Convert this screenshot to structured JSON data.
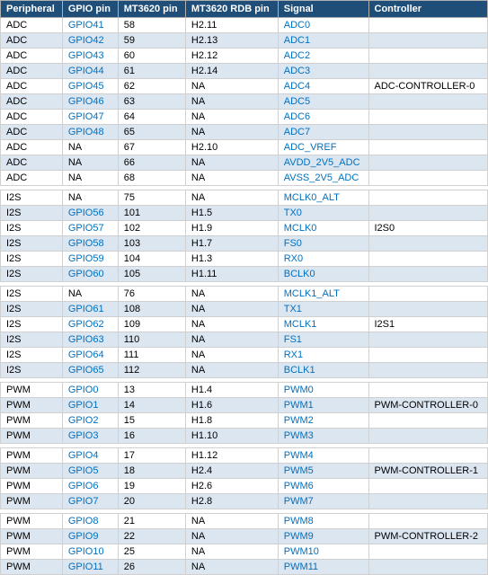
{
  "table": {
    "headers": [
      "Peripheral",
      "GPIO pin",
      "MT3620 pin",
      "MT3620 RDB pin",
      "Signal",
      "Controller"
    ],
    "rows": [
      {
        "peripheral": "ADC",
        "gpio": "GPIO41",
        "mt": "58",
        "rdb": "H2.11",
        "signal": "ADC0",
        "controller": "",
        "bg": "odd"
      },
      {
        "peripheral": "ADC",
        "gpio": "GPIO42",
        "mt": "59",
        "rdb": "H2.13",
        "signal": "ADC1",
        "controller": "",
        "bg": "even"
      },
      {
        "peripheral": "ADC",
        "gpio": "GPIO43",
        "mt": "60",
        "rdb": "H2.12",
        "signal": "ADC2",
        "controller": "",
        "bg": "odd"
      },
      {
        "peripheral": "ADC",
        "gpio": "GPIO44",
        "mt": "61",
        "rdb": "H2.14",
        "signal": "ADC3",
        "controller": "",
        "bg": "even"
      },
      {
        "peripheral": "ADC",
        "gpio": "GPIO45",
        "mt": "62",
        "rdb": "NA",
        "signal": "ADC4",
        "controller": "ADC-CONTROLLER-0",
        "bg": "odd"
      },
      {
        "peripheral": "ADC",
        "gpio": "GPIO46",
        "mt": "63",
        "rdb": "NA",
        "signal": "ADC5",
        "controller": "",
        "bg": "even"
      },
      {
        "peripheral": "ADC",
        "gpio": "GPIO47",
        "mt": "64",
        "rdb": "NA",
        "signal": "ADC6",
        "controller": "",
        "bg": "odd"
      },
      {
        "peripheral": "ADC",
        "gpio": "GPIO48",
        "mt": "65",
        "rdb": "NA",
        "signal": "ADC7",
        "controller": "",
        "bg": "even"
      },
      {
        "peripheral": "ADC",
        "gpio": "NA",
        "mt": "67",
        "rdb": "H2.10",
        "signal": "ADC_VREF",
        "controller": "",
        "bg": "odd"
      },
      {
        "peripheral": "ADC",
        "gpio": "NA",
        "mt": "66",
        "rdb": "NA",
        "signal": "AVDD_2V5_ADC",
        "controller": "",
        "bg": "even"
      },
      {
        "peripheral": "ADC",
        "gpio": "NA",
        "mt": "68",
        "rdb": "NA",
        "signal": "AVSS_2V5_ADC",
        "controller": "",
        "bg": "odd"
      },
      {
        "peripheral": "SPACER",
        "bg": "spacer"
      },
      {
        "peripheral": "I2S",
        "gpio": "NA",
        "mt": "75",
        "rdb": "NA",
        "signal": "MCLK0_ALT",
        "controller": "",
        "bg": "odd"
      },
      {
        "peripheral": "I2S",
        "gpio": "GPIO56",
        "mt": "101",
        "rdb": "H1.5",
        "signal": "TX0",
        "controller": "",
        "bg": "even"
      },
      {
        "peripheral": "I2S",
        "gpio": "GPIO57",
        "mt": "102",
        "rdb": "H1.9",
        "signal": "MCLK0",
        "controller": "I2S0",
        "bg": "odd"
      },
      {
        "peripheral": "I2S",
        "gpio": "GPIO58",
        "mt": "103",
        "rdb": "H1.7",
        "signal": "FS0",
        "controller": "",
        "bg": "even"
      },
      {
        "peripheral": "I2S",
        "gpio": "GPIO59",
        "mt": "104",
        "rdb": "H1.3",
        "signal": "RX0",
        "controller": "",
        "bg": "odd"
      },
      {
        "peripheral": "I2S",
        "gpio": "GPIO60",
        "mt": "105",
        "rdb": "H1.11",
        "signal": "BCLK0",
        "controller": "",
        "bg": "even"
      },
      {
        "peripheral": "SPACER",
        "bg": "spacer"
      },
      {
        "peripheral": "I2S",
        "gpio": "NA",
        "mt": "76",
        "rdb": "NA",
        "signal": "MCLK1_ALT",
        "controller": "",
        "bg": "odd"
      },
      {
        "peripheral": "I2S",
        "gpio": "GPIO61",
        "mt": "108",
        "rdb": "NA",
        "signal": "TX1",
        "controller": "",
        "bg": "even"
      },
      {
        "peripheral": "I2S",
        "gpio": "GPIO62",
        "mt": "109",
        "rdb": "NA",
        "signal": "MCLK1",
        "controller": "I2S1",
        "bg": "odd"
      },
      {
        "peripheral": "I2S",
        "gpio": "GPIO63",
        "mt": "110",
        "rdb": "NA",
        "signal": "FS1",
        "controller": "",
        "bg": "even"
      },
      {
        "peripheral": "I2S",
        "gpio": "GPIO64",
        "mt": "111",
        "rdb": "NA",
        "signal": "RX1",
        "controller": "",
        "bg": "odd"
      },
      {
        "peripheral": "I2S",
        "gpio": "GPIO65",
        "mt": "112",
        "rdb": "NA",
        "signal": "BCLK1",
        "controller": "",
        "bg": "even"
      },
      {
        "peripheral": "SPACER",
        "bg": "spacer"
      },
      {
        "peripheral": "PWM",
        "gpio": "GPIO0",
        "mt": "13",
        "rdb": "H1.4",
        "signal": "PWM0",
        "controller": "",
        "bg": "odd"
      },
      {
        "peripheral": "PWM",
        "gpio": "GPIO1",
        "mt": "14",
        "rdb": "H1.6",
        "signal": "PWM1",
        "controller": "PWM-CONTROLLER-0",
        "bg": "even"
      },
      {
        "peripheral": "PWM",
        "gpio": "GPIO2",
        "mt": "15",
        "rdb": "H1.8",
        "signal": "PWM2",
        "controller": "",
        "bg": "odd"
      },
      {
        "peripheral": "PWM",
        "gpio": "GPIO3",
        "mt": "16",
        "rdb": "H1.10",
        "signal": "PWM3",
        "controller": "",
        "bg": "even"
      },
      {
        "peripheral": "SPACER",
        "bg": "spacer"
      },
      {
        "peripheral": "PWM",
        "gpio": "GPIO4",
        "mt": "17",
        "rdb": "H1.12",
        "signal": "PWM4",
        "controller": "",
        "bg": "odd"
      },
      {
        "peripheral": "PWM",
        "gpio": "GPIO5",
        "mt": "18",
        "rdb": "H2.4",
        "signal": "PWM5",
        "controller": "PWM-CONTROLLER-1",
        "bg": "even"
      },
      {
        "peripheral": "PWM",
        "gpio": "GPIO6",
        "mt": "19",
        "rdb": "H2.6",
        "signal": "PWM6",
        "controller": "",
        "bg": "odd"
      },
      {
        "peripheral": "PWM",
        "gpio": "GPIO7",
        "mt": "20",
        "rdb": "H2.8",
        "signal": "PWM7",
        "controller": "",
        "bg": "even"
      },
      {
        "peripheral": "SPACER",
        "bg": "spacer"
      },
      {
        "peripheral": "PWM",
        "gpio": "GPIO8",
        "mt": "21",
        "rdb": "NA",
        "signal": "PWM8",
        "controller": "",
        "bg": "odd"
      },
      {
        "peripheral": "PWM",
        "gpio": "GPIO9",
        "mt": "22",
        "rdb": "NA",
        "signal": "PWM9",
        "controller": "PWM-CONTROLLER-2",
        "bg": "even"
      },
      {
        "peripheral": "PWM",
        "gpio": "GPIO10",
        "mt": "25",
        "rdb": "NA",
        "signal": "PWM10",
        "controller": "",
        "bg": "odd"
      },
      {
        "peripheral": "PWM",
        "gpio": "GPIO11",
        "mt": "26",
        "rdb": "NA",
        "signal": "PWM11",
        "controller": "",
        "bg": "even"
      }
    ]
  }
}
